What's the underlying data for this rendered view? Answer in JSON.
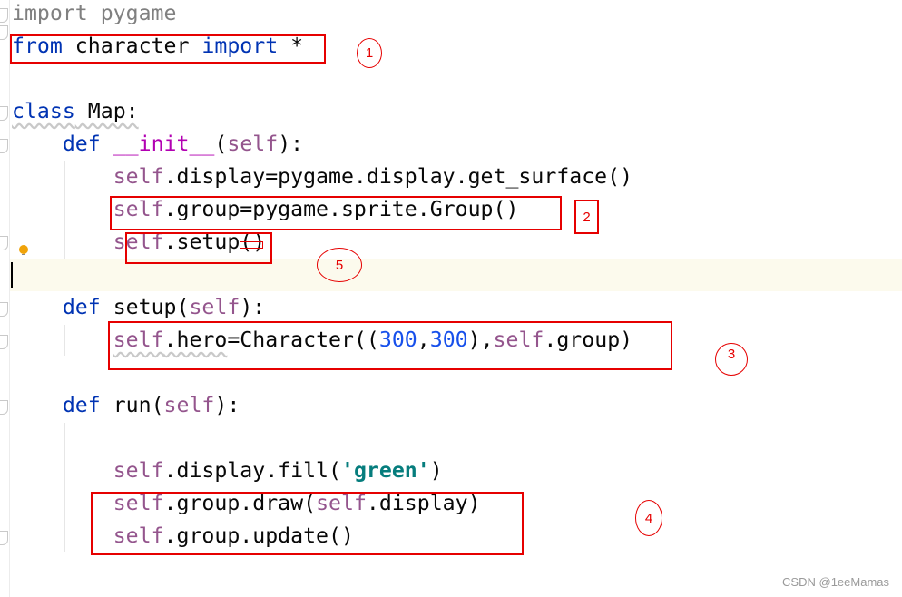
{
  "code_lines": [
    [
      {
        "t": "import pygame",
        "c": "unused"
      }
    ],
    [
      {
        "t": "from",
        "c": "kw"
      },
      {
        "t": " character "
      },
      {
        "t": "import",
        "c": "kw"
      },
      {
        "t": " *"
      }
    ],
    [],
    [
      {
        "t": "class",
        "c": "kw wavy"
      },
      {
        "t": " Map:",
        "c": "wavy"
      }
    ],
    [
      {
        "t": "    "
      },
      {
        "t": "def",
        "c": "kw"
      },
      {
        "t": " "
      },
      {
        "t": "__init__",
        "c": "dunder"
      },
      {
        "t": "("
      },
      {
        "t": "self",
        "c": "self"
      },
      {
        "t": "):"
      }
    ],
    [
      {
        "t": "        "
      },
      {
        "t": "self",
        "c": "self"
      },
      {
        "t": ".display=pygame.display.get_surface()"
      }
    ],
    [
      {
        "t": "        "
      },
      {
        "t": "self",
        "c": "self"
      },
      {
        "t": ".group=pygame.sprite.Group()"
      }
    ],
    [
      {
        "t": "        "
      },
      {
        "t": "self",
        "c": "self"
      },
      {
        "t": ".setup()"
      }
    ],
    [],
    [
      {
        "t": "    "
      },
      {
        "t": "def",
        "c": "kw"
      },
      {
        "t": " setup("
      },
      {
        "t": "self",
        "c": "self"
      },
      {
        "t": "):"
      }
    ],
    [
      {
        "t": "        "
      },
      {
        "t": "self",
        "c": "self wavy"
      },
      {
        "t": ".hero",
        "c": "wavy"
      },
      {
        "t": "=Character(("
      },
      {
        "t": "300",
        "c": "num"
      },
      {
        "t": ","
      },
      {
        "t": "300",
        "c": "num"
      },
      {
        "t": "),"
      },
      {
        "t": "self",
        "c": "self"
      },
      {
        "t": ".group)"
      }
    ],
    [],
    [
      {
        "t": "    "
      },
      {
        "t": "def",
        "c": "kw"
      },
      {
        "t": " run("
      },
      {
        "t": "self",
        "c": "self"
      },
      {
        "t": "):"
      }
    ],
    [],
    [
      {
        "t": "        "
      },
      {
        "t": "self",
        "c": "self"
      },
      {
        "t": ".display.fill("
      },
      {
        "t": "'green'",
        "c": "str"
      },
      {
        "t": ")"
      }
    ],
    [
      {
        "t": "        "
      },
      {
        "t": "self",
        "c": "self"
      },
      {
        "t": ".group.draw("
      },
      {
        "t": "self",
        "c": "self"
      },
      {
        "t": ".display)"
      }
    ],
    [
      {
        "t": "        "
      },
      {
        "t": "self",
        "c": "self"
      },
      {
        "t": ".group.update()"
      }
    ]
  ],
  "annotations": [
    "1",
    "2",
    "3",
    "4",
    "5"
  ],
  "watermark": "CSDN @1eeMamas",
  "colors": {
    "keyword": "#0033b3",
    "self": "#94558d",
    "dunder": "#b200b2",
    "number": "#1750eb",
    "string": "#067d7d",
    "annotation": "#e60000",
    "current_line": "#fcfaed"
  },
  "icons": {
    "intention_bulb": "lightbulb-icon"
  }
}
